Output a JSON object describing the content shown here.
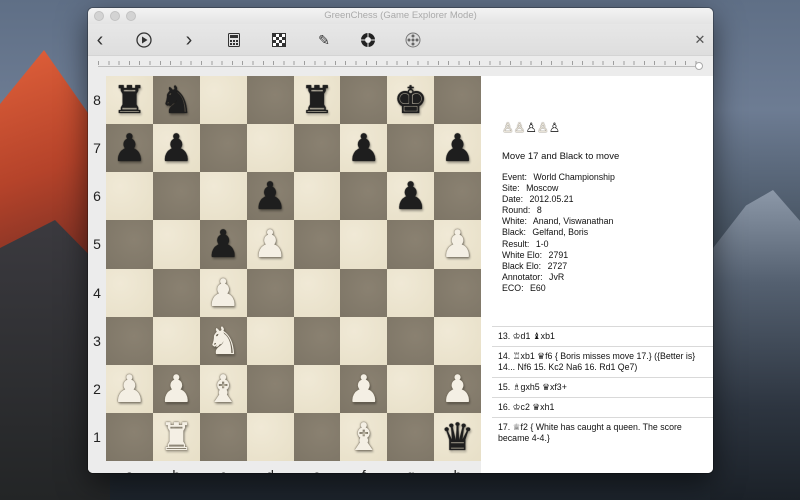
{
  "window": {
    "title": "GreenChess (Game Explorer Mode)"
  },
  "toolbar": {
    "back_icon": "‹",
    "play_icon": "▷",
    "forward_icon": "›",
    "calculator_icon": "▦",
    "board_icon": "▩",
    "edit_icon": "✎",
    "engine_icon": "✺",
    "openings_icon": "❂",
    "close_icon": "✕"
  },
  "board": {
    "ranks": [
      "8",
      "7",
      "6",
      "5",
      "4",
      "3",
      "2",
      "1"
    ],
    "files": [
      "a",
      "b",
      "c",
      "d",
      "e",
      "f",
      "g",
      "h"
    ],
    "position": [
      [
        "br",
        "bn",
        "",
        "",
        "br",
        "",
        "bk",
        ""
      ],
      [
        "bp",
        "bp",
        "",
        "",
        "",
        "bp",
        "",
        "bp"
      ],
      [
        "",
        "",
        "",
        "bp",
        "",
        "",
        "bp",
        ""
      ],
      [
        "",
        "",
        "bp",
        "wp",
        "",
        "",
        "",
        "wp"
      ],
      [
        "",
        "",
        "wp",
        "",
        "",
        "",
        "",
        ""
      ],
      [
        "",
        "",
        "wn",
        "",
        "",
        "",
        "",
        ""
      ],
      [
        "wp",
        "wp",
        "wb",
        "",
        "",
        "wp",
        "",
        "wp"
      ],
      [
        "",
        "wr",
        "",
        "",
        "",
        "wb",
        "",
        "bq"
      ]
    ]
  },
  "captured": [
    "♙",
    "♙",
    "♙",
    "♙",
    "♙"
  ],
  "status": "Move 17 and Black to move",
  "game_info": [
    {
      "key": "Event:",
      "value": "World Championship"
    },
    {
      "key": "Site:",
      "value": "Moscow"
    },
    {
      "key": "Date:",
      "value": "2012.05.21"
    },
    {
      "key": "Round:",
      "value": "8"
    },
    {
      "key": "White:",
      "value": "Anand, Viswanathan"
    },
    {
      "key": "Black:",
      "value": "Gelfand, Boris"
    },
    {
      "key": "Result:",
      "value": "1-0"
    },
    {
      "key": "White Elo:",
      "value": "2791"
    },
    {
      "key": "Black Elo:",
      "value": "2727"
    },
    {
      "key": "Annotator:",
      "value": "JvR"
    },
    {
      "key": "ECO:",
      "value": "E60"
    }
  ],
  "moves": [
    "13. ♔d1  ♝xb1",
    "14. ♖xb1  ♛f6 { Boris misses move 17.} ({Better is} 14... Nf6 15. Kc2 Na6 16. Rd1 Qe7)",
    "15. ♗gxh5  ♛xf3+",
    "16. ♔c2  ♛xh1",
    "17. ♕f2 { White has caught a queen. The score became 4-4.}"
  ]
}
